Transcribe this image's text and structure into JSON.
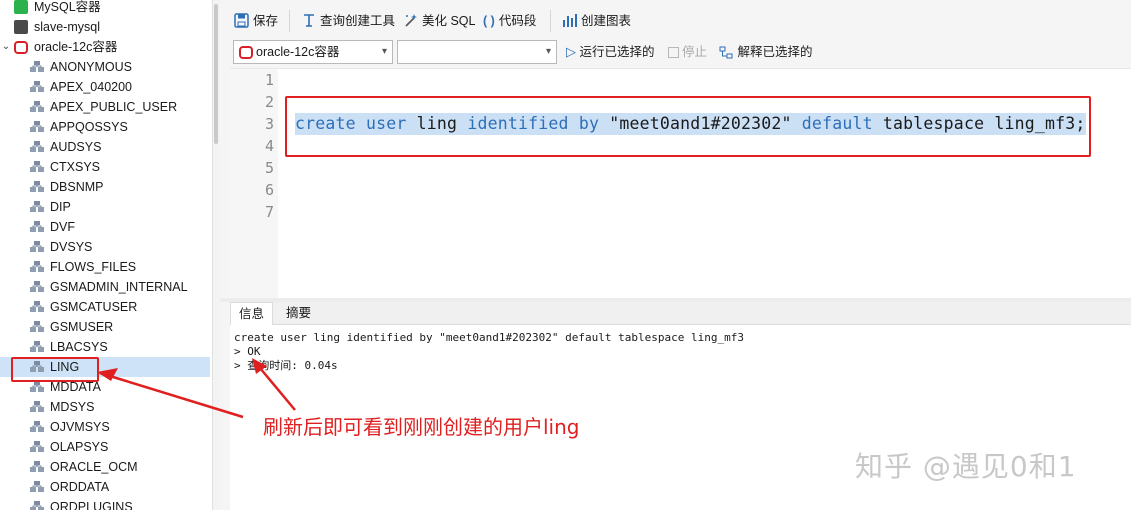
{
  "sidebar": {
    "connections": [
      {
        "label": "MySQL容器",
        "color": "#2bb24c"
      },
      {
        "label": "slave-mysql",
        "color": "#4a4a4a"
      },
      {
        "label": "oracle-12c容器",
        "color": "#d8202a"
      }
    ],
    "users": [
      {
        "label": "ANONYMOUS"
      },
      {
        "label": "APEX_040200"
      },
      {
        "label": "APEX_PUBLIC_USER"
      },
      {
        "label": "APPQOSSYS"
      },
      {
        "label": "AUDSYS"
      },
      {
        "label": "CTXSYS"
      },
      {
        "label": "DBSNMP"
      },
      {
        "label": "DIP"
      },
      {
        "label": "DVF"
      },
      {
        "label": "DVSYS"
      },
      {
        "label": "FLOWS_FILES"
      },
      {
        "label": "GSMADMIN_INTERNAL"
      },
      {
        "label": "GSMCATUSER"
      },
      {
        "label": "GSMUSER"
      },
      {
        "label": "LBACSYS"
      },
      {
        "label": "LING"
      },
      {
        "label": "MDDATA"
      },
      {
        "label": "MDSYS"
      },
      {
        "label": "OJVMSYS"
      },
      {
        "label": "OLAPSYS"
      },
      {
        "label": "ORACLE_OCM"
      },
      {
        "label": "ORDDATA"
      },
      {
        "label": "ORDPLUGINS"
      }
    ],
    "selected": "LING"
  },
  "toolbar": {
    "save": "保存",
    "query_builder": "查询创建工具",
    "beautify": "美化 SQL",
    "code_snippet": "代码段",
    "create_chart": "创建图表"
  },
  "selectbar": {
    "connection_value": "oracle-12c容器",
    "database_value": "",
    "run_selected": "运行已选择的",
    "stop": "停止",
    "explain_selected": "解释已选择的"
  },
  "editor": {
    "line_numbers": [
      "1",
      "2",
      "3",
      "4",
      "5",
      "6",
      "7"
    ],
    "code": {
      "kw_create": "create",
      "kw_user": "user",
      "name": "ling",
      "kw_identified": "identified",
      "kw_by": "by",
      "password": "\"meet0and1#202302\"",
      "kw_default": "default",
      "kw_tablespace": "tablespace",
      "tablespace": "ling_mf3;"
    }
  },
  "result": {
    "tabs": [
      "信息",
      "摘要"
    ],
    "lines": [
      "create user ling identified by \"meet0and1#202302\" default tablespace ling_mf3",
      "> OK",
      "> 查询时间: 0.04s"
    ]
  },
  "annotation": {
    "text": "刷新后即可看到刚刚创建的用户ling",
    "color": "#e02020"
  },
  "watermark": "知乎 @遇见0和1"
}
